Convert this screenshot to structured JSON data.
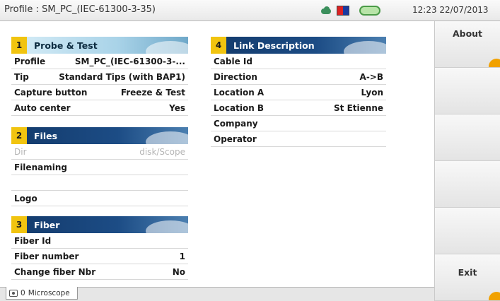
{
  "titlebar": {
    "title": "Profile : SM_PC_(IEC-61300-3-35)",
    "datetime": "12:23 22/07/2013",
    "icons": [
      "cloud-icon",
      "flag-icon",
      "battery-icon"
    ]
  },
  "panels": {
    "probe": {
      "number": "1",
      "title": "Probe & Test",
      "rows": [
        {
          "k": "Profile",
          "v": "SM_PC_(IEC-61300-3-..."
        },
        {
          "k": "Tip",
          "v": "Standard Tips (with BAP1)"
        },
        {
          "k": "Capture button",
          "v": "Freeze & Test"
        },
        {
          "k": "Auto center",
          "v": "Yes"
        }
      ]
    },
    "files": {
      "number": "2",
      "title": "Files",
      "rows": [
        {
          "k": "Dir",
          "v": "disk/Scope"
        },
        {
          "k": "Filenaming",
          "v": ""
        },
        {
          "k": "",
          "v": ""
        },
        {
          "k": "Logo",
          "v": ""
        }
      ]
    },
    "fiber": {
      "number": "3",
      "title": "Fiber",
      "rows": [
        {
          "k": "Fiber Id",
          "v": ""
        },
        {
          "k": "Fiber number",
          "v": "1"
        },
        {
          "k": "Change fiber Nbr",
          "v": "No"
        }
      ]
    },
    "link": {
      "number": "4",
      "title": "Link Description",
      "rows": [
        {
          "k": "Cable Id",
          "v": ""
        },
        {
          "k": "Direction",
          "v": "A->B"
        },
        {
          "k": "Location A",
          "v": "Lyon"
        },
        {
          "k": "Location B",
          "v": "St Etienne"
        },
        {
          "k": "Company",
          "v": ""
        },
        {
          "k": "Operator",
          "v": ""
        }
      ]
    }
  },
  "sidemenu": {
    "buttons": [
      "About",
      "",
      "",
      "",
      "",
      "Exit"
    ]
  },
  "tabs": [
    {
      "label": "Microscope",
      "badge": "0"
    }
  ],
  "colors": {
    "accent_yellow": "#f1c40f",
    "header_dark": "#1c4c85",
    "header_light": "#a9d3e8",
    "menu_corner": "#f1a100"
  }
}
